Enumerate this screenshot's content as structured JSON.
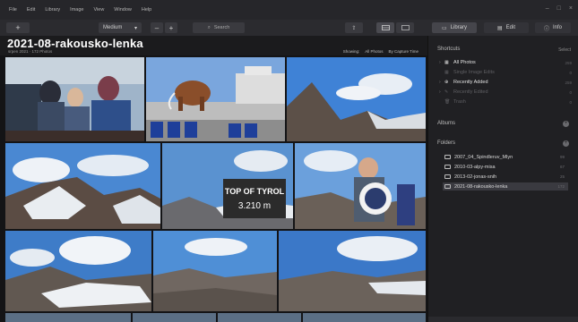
{
  "menu": [
    "File",
    "Edit",
    "Library",
    "Image",
    "View",
    "Window",
    "Help"
  ],
  "window_controls": [
    "–",
    "□",
    "×"
  ],
  "toolbar": {
    "add_label": "+",
    "zoom_label": "Medium",
    "zoom_caret": "▾",
    "minus_label": "–",
    "plus_label": "+",
    "search_icon": "⌕",
    "search_label": "Search",
    "share_icon": "⇪",
    "tabs": [
      {
        "icon": "▭",
        "label": "Library"
      },
      {
        "icon": "▤",
        "label": "Edit"
      },
      {
        "icon": "ⓘ",
        "label": "Info"
      }
    ]
  },
  "header": {
    "title": "2021-08-rakousko-lenka",
    "subtitle": "srpen 2021 · 172 Photos",
    "showing_label": "Showing:",
    "showing_value": "All Photos",
    "sort_value": "By Capture Time"
  },
  "panel": {
    "shortcuts_title": "Shortcuts",
    "shortcuts_action": "Select",
    "shortcuts": [
      {
        "icon": "▦",
        "label": "All Photos",
        "count": "259",
        "dim": false
      },
      {
        "icon": "▦",
        "label": "Single Image Edits",
        "count": "0",
        "dim": true
      },
      {
        "icon": "⊕",
        "label": "Recently Added",
        "count": "259",
        "dim": false
      },
      {
        "icon": "✎",
        "label": "Recently Edited",
        "count": "0",
        "dim": true
      },
      {
        "icon": "🗑",
        "label": "Trash",
        "count": "0",
        "dim": true
      }
    ],
    "albums_title": "Albums",
    "folders_title": "Folders",
    "add_icon": "+",
    "folders": [
      {
        "label": "2007_04_Spindleruv_Mlyn",
        "count": "99"
      },
      {
        "label": "2010-03-alpy-misa",
        "count": "67"
      },
      {
        "label": "2013-02-jonas-snih",
        "count": "25"
      },
      {
        "label": "2021-08-rakousko-lenka",
        "count": "172"
      }
    ]
  },
  "photos": [
    {
      "kind": "kids",
      "sky": "#9fb4c9"
    },
    {
      "kind": "mammoth",
      "sky": "#6f9fd8"
    },
    {
      "kind": "mountain",
      "sky": "#3f82d6"
    },
    {
      "kind": "mountain",
      "sky": "#4a88d2"
    },
    {
      "kind": "sign",
      "sky": "#5a92d0",
      "sign_text": "TOP OF TYROL",
      "sign_alt": "3.210 m"
    },
    {
      "kind": "boy",
      "sky": "#6ba0dc"
    },
    {
      "kind": "snow",
      "sky": "#3e7cc8"
    },
    {
      "kind": "rocks",
      "sky": "#4f8fd6"
    },
    {
      "kind": "rocks",
      "sky": "#3b78c8"
    },
    {
      "kind": "strip",
      "sky": "#5b6f85"
    }
  ]
}
